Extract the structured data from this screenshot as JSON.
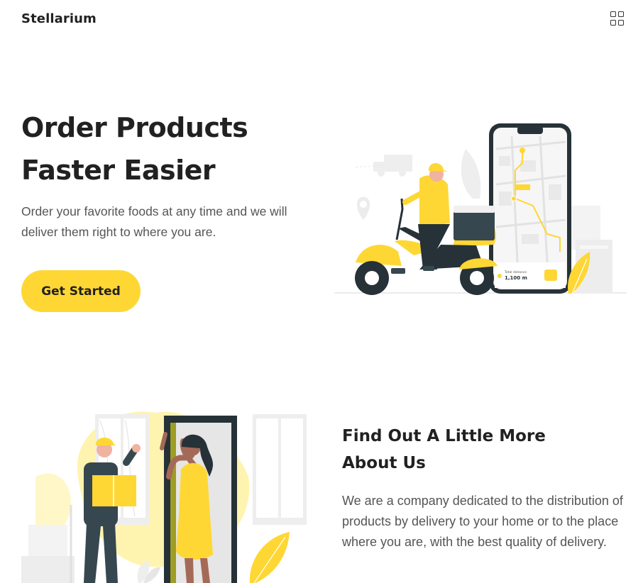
{
  "header": {
    "logo": "Stellarium",
    "menu_icon": "grid-menu-icon"
  },
  "hero": {
    "title_line1": "Order Products",
    "title_line2": "Faster Easier",
    "subtitle": "Order your favorite foods at any time and we will deliver them right to where you are.",
    "cta_label": "Get Started",
    "illustration": {
      "name": "delivery-scooter-illustration",
      "phone_distance_label": "Total distance",
      "phone_distance_value": "1,100 m"
    }
  },
  "about": {
    "title_line1": "Find Out A Little More",
    "title_line2": "About Us",
    "text": "We are a company dedicated to the distribution of products by delivery to your home or to the place where you are, with the best quality of delivery.",
    "illustration": "doorstep-delivery-illustration"
  },
  "colors": {
    "accent": "#fed734",
    "text_dark": "#212121",
    "text_body": "#555555",
    "illustration_dark": "#37474f"
  }
}
